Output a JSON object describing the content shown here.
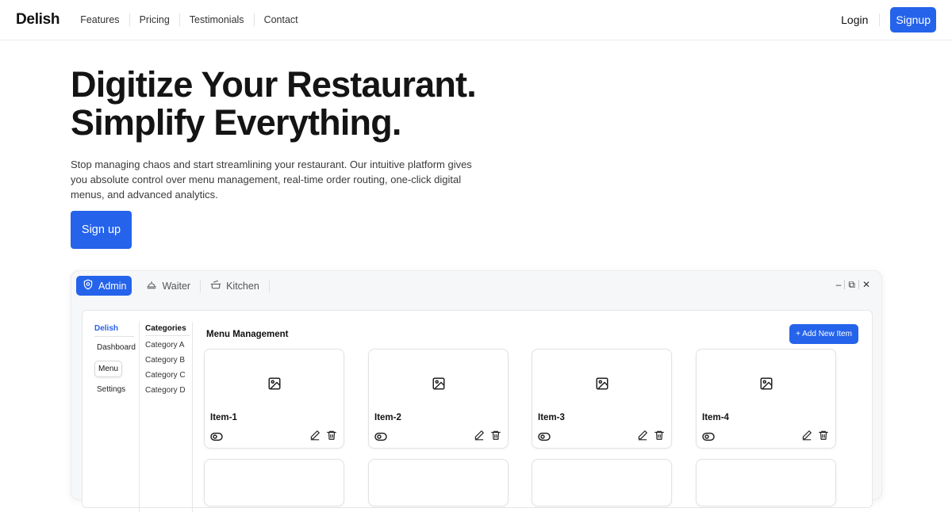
{
  "nav": {
    "brand": "Delish",
    "links": [
      "Features",
      "Pricing",
      "Testimonials",
      "Contact"
    ],
    "login": "Login",
    "signup": "Signup"
  },
  "hero": {
    "title_line1": "Digitize Your Restaurant.",
    "title_line2": "Simplify Everything.",
    "description": "Stop managing chaos and start streamlining your restaurant. Our intuitive platform gives you absolute control over menu management, real-time order routing, one-click digital menus, and advanced analytics.",
    "cta": "Sign up"
  },
  "app": {
    "tabs": [
      {
        "label": "Admin",
        "icon": "shield-icon",
        "active": true
      },
      {
        "label": "Waiter",
        "icon": "waiter-icon",
        "active": false
      },
      {
        "label": "Kitchen",
        "icon": "cooking-pot-icon",
        "active": false
      }
    ],
    "window_controls": [
      "–",
      "⧉",
      "✕"
    ],
    "sidebar": {
      "title": "Delish",
      "items": [
        "Dashboard",
        "Menu",
        "Settings"
      ],
      "active": "Menu"
    },
    "categories": {
      "title": "Categories",
      "items": [
        "Category A",
        "Category B",
        "Category C",
        "Category D"
      ]
    },
    "main": {
      "title": "Menu Management",
      "add_button": "+ Add New Item",
      "items": [
        {
          "name": "Item-1"
        },
        {
          "name": "Item-2"
        },
        {
          "name": "Item-3"
        },
        {
          "name": "Item-4"
        }
      ]
    }
  },
  "colors": {
    "accent": "#2563eb",
    "text": "#141414"
  }
}
